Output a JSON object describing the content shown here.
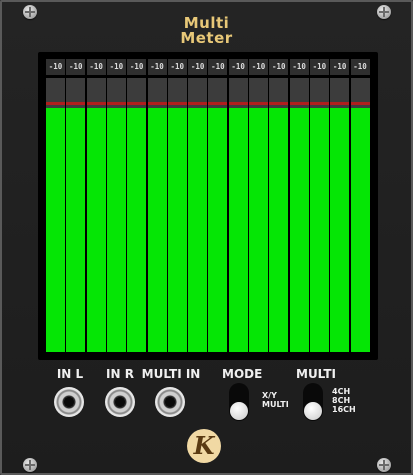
{
  "module": {
    "title_line1": "Multi",
    "title_line2": "Meter"
  },
  "meters": [
    {
      "channel": 1,
      "label": "-10",
      "level": 0.89,
      "peak": 0.9
    },
    {
      "channel": 2,
      "label": "-10",
      "level": 0.89,
      "peak": 0.9
    },
    {
      "channel": 3,
      "label": "-10",
      "level": 0.89,
      "peak": 0.9
    },
    {
      "channel": 4,
      "label": "-10",
      "level": 0.89,
      "peak": 0.9
    },
    {
      "channel": 5,
      "label": "-10",
      "level": 0.89,
      "peak": 0.9
    },
    {
      "channel": 6,
      "label": "-10",
      "level": 0.89,
      "peak": 0.9
    },
    {
      "channel": 7,
      "label": "-10",
      "level": 0.89,
      "peak": 0.9
    },
    {
      "channel": 8,
      "label": "-10",
      "level": 0.89,
      "peak": 0.9
    },
    {
      "channel": 9,
      "label": "-10",
      "level": 0.89,
      "peak": 0.9
    },
    {
      "channel": 10,
      "label": "-10",
      "level": 0.89,
      "peak": 0.9
    },
    {
      "channel": 11,
      "label": "-10",
      "level": 0.89,
      "peak": 0.9
    },
    {
      "channel": 12,
      "label": "-10",
      "level": 0.89,
      "peak": 0.9
    },
    {
      "channel": 13,
      "label": "-10",
      "level": 0.89,
      "peak": 0.9
    },
    {
      "channel": 14,
      "label": "-10",
      "level": 0.89,
      "peak": 0.9
    },
    {
      "channel": 15,
      "label": "-10",
      "level": 0.89,
      "peak": 0.9
    },
    {
      "channel": 16,
      "label": "-10",
      "level": 0.89,
      "peak": 0.9
    }
  ],
  "inputs": {
    "in_l": "IN L",
    "in_r": "IN R",
    "multi_in": "MULTI IN"
  },
  "mode_switch": {
    "label": "MODE",
    "options": [
      "X/Y",
      "MULTI"
    ],
    "selected": "MULTI"
  },
  "multi_switch": {
    "label": "MULTI",
    "options": [
      "4CH",
      "8CH",
      "16CH"
    ],
    "selected": "16CH"
  },
  "logo": {
    "letter": "K"
  },
  "colors": {
    "panel": "#1f1f1f",
    "title": "#e8c878",
    "meter_fill": "#05e605",
    "meter_peak": "#b01e1e",
    "meter_track": "#3c3c3c",
    "logo_bg": "#f1d9a4"
  }
}
